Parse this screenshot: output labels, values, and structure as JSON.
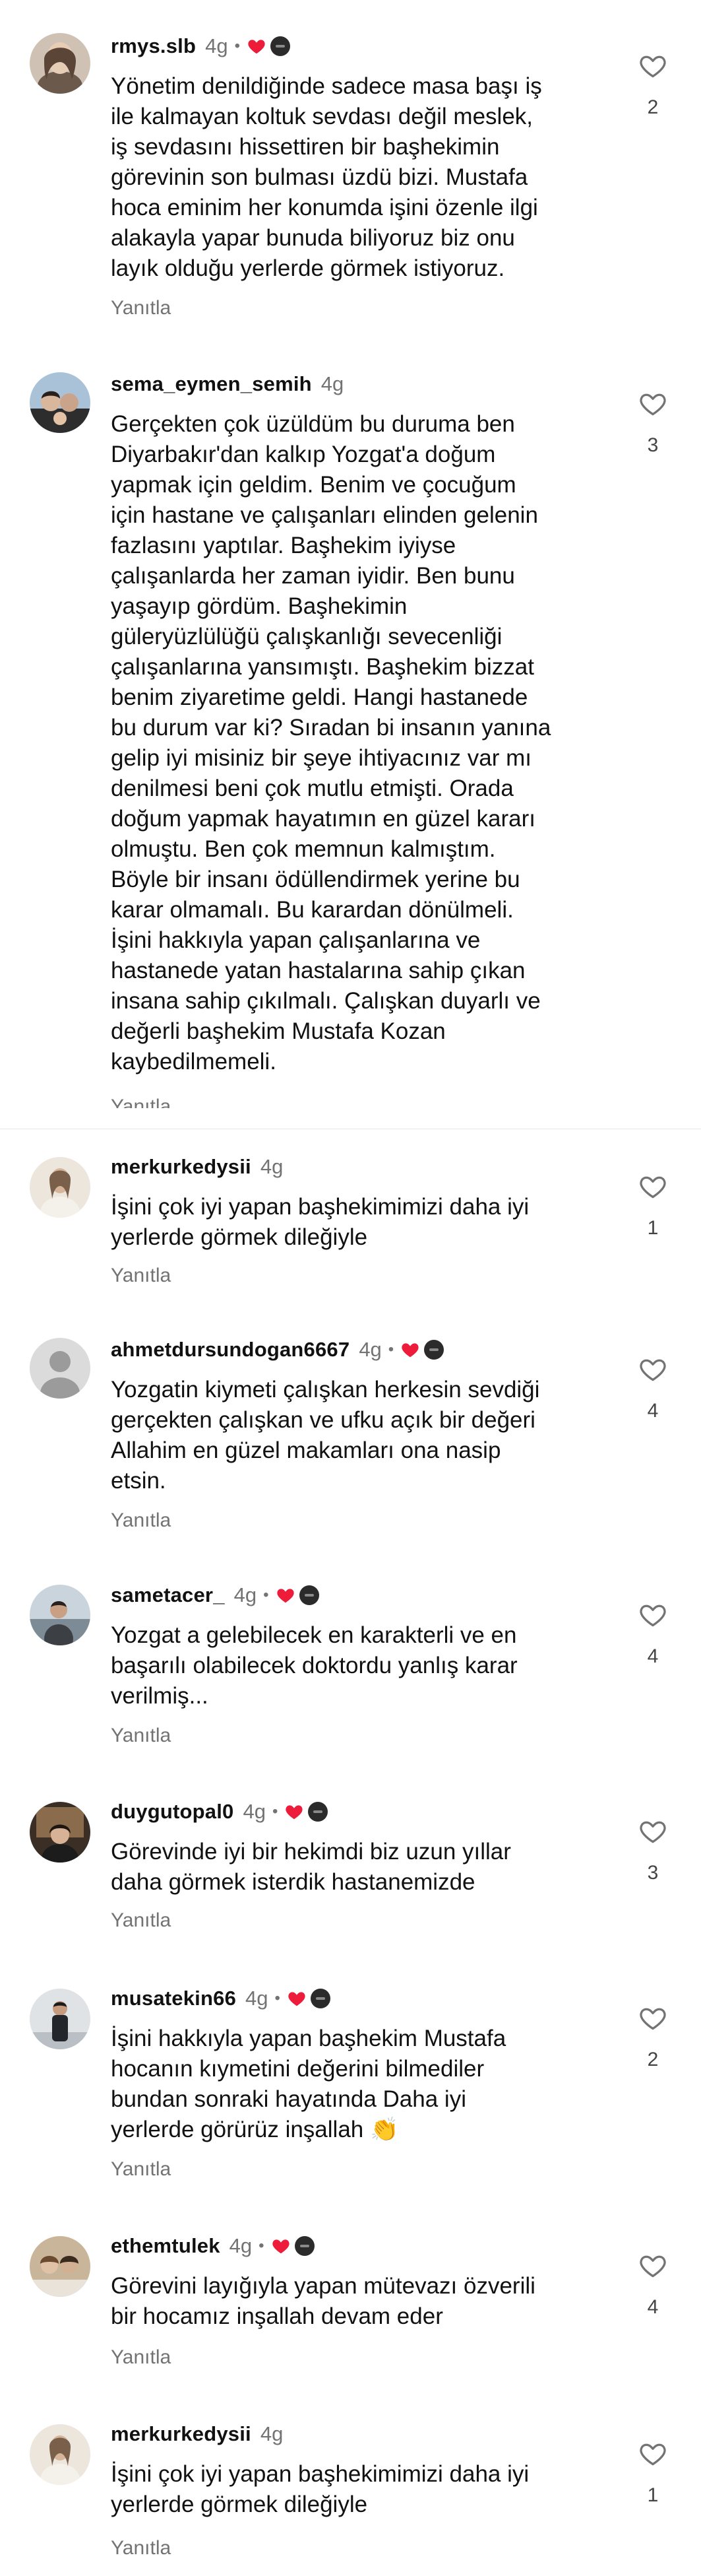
{
  "reply_label": "Yanıtla",
  "colors": {
    "heart_red": "#ed1c3a",
    "muted": "#737373",
    "creator_badge": "#2b2b2b"
  },
  "icons": {
    "like": "heart-outline-icon",
    "creator_heart": "red-heart-icon",
    "creator_avatar": "creator-badge-icon"
  },
  "comments": [
    {
      "username": "rmys.slb",
      "time": "4g",
      "liked_by_creator": true,
      "text": "Yönetim denildiğinde sadece masa başı iş\nile kalmayan koltuk sevdası değil meslek,\niş sevdasını hissettiren bir başhekimin\ngörevinin son bulması üzdü bizi. Mustafa\nhoca eminim her konumda işini özenle ilgi\nalakayla yapar bunuda biliyoruz  biz onu\nlayık olduğu  yerlerde görmek istiyoruz.",
      "likes": "2"
    },
    {
      "username": "sema_eymen_semih",
      "time": "4g",
      "liked_by_creator": false,
      "text": "Gerçekten çok üzüldüm bu duruma ben\nDiyarbakır'dan kalkıp Yozgat'a doğum\nyapmak için geldim. Benim ve çocuğum\niçin hastane ve çalışanları elinden gelenin\nfazlasını yaptılar. Başhekim iyiyse\nçalışanlarda her zaman iyidir. Ben bunu\nyaşayıp gördüm. Başhekimin\ngüleryüzlülüğü çalışkanlığı sevecenliği\nçalışanlarına yansımıştı. Başhekim bizzat\nbenim ziyaretime geldi. Hangi hastanede\nbu durum var ki? Sıradan bi insanın yanına\ngelip iyi misiniz bir şeye ihtiyacınız var mı\ndenilmesi beni çok mutlu etmişti. Orada\ndoğum yapmak hayatımın en güzel kararı\nolmuştu. Ben çok memnun kalmıştım.\nBöyle bir insanı ödüllendirmek yerine bu\nkarar olmamalı. Bu karardan dönülmeli.\nİşini hakkıyla yapan çalışanlarına ve\nhastanede yatan hastalarına sahip çıkan\ninsana sahip çıkılmalı. Çalışkan duyarlı ve\ndeğerli başhekim Mustafa Kozan\nkaybedilmemeli.",
      "likes": "3"
    },
    {
      "username": "merkurkedysii",
      "time": "4g",
      "liked_by_creator": false,
      "text": "İşini çok iyi yapan başhekimimizi daha iyi\nyerlerde görmek dileğiyle",
      "likes": "1"
    },
    {
      "username": "ahmetdursundogan6667",
      "time": "4g",
      "liked_by_creator": true,
      "text": "Yozgatin kiymeti  çalışkan herkesin sevdiği\ngerçekten çalışkan ve ufku açık bir değeri\nAllahim en güzel makamları ona nasip\netsin.",
      "likes": "4"
    },
    {
      "username": "sametacer_",
      "time": "4g",
      "liked_by_creator": true,
      "text": "Yozgat a gelebilecek en karakterli ve en\nbaşarılı olabilecek doktordu yanlış karar\nverilmiş...",
      "likes": "4"
    },
    {
      "username": "duygutopal0",
      "time": "4g",
      "liked_by_creator": true,
      "text": "Görevinde iyi bir hekimdi biz uzun yıllar\ndaha görmek isterdik hastanemizde",
      "likes": "3"
    },
    {
      "username": "musatekin66",
      "time": "4g",
      "liked_by_creator": true,
      "text": "İşini hakkıyla yapan  başhekim  Mustafa\nhocanın  kıymetini değerini bilmediler\nbundan sonraki hayatında Daha iyi\nyerlerde görürüz inşallah 👏",
      "likes": "2"
    },
    {
      "username": "ethemtulek",
      "time": "4g",
      "liked_by_creator": true,
      "text": "Görevini layığıyla yapan mütevazı özverili\nbir hocamız inşallah devam eder",
      "likes": "4"
    },
    {
      "username": "merkurkedysii",
      "time": "4g",
      "liked_by_creator": false,
      "text": "İşini çok iyi yapan başhekimimizi daha iyi\nyerlerde görmek dileğiyle",
      "likes": "1"
    }
  ]
}
